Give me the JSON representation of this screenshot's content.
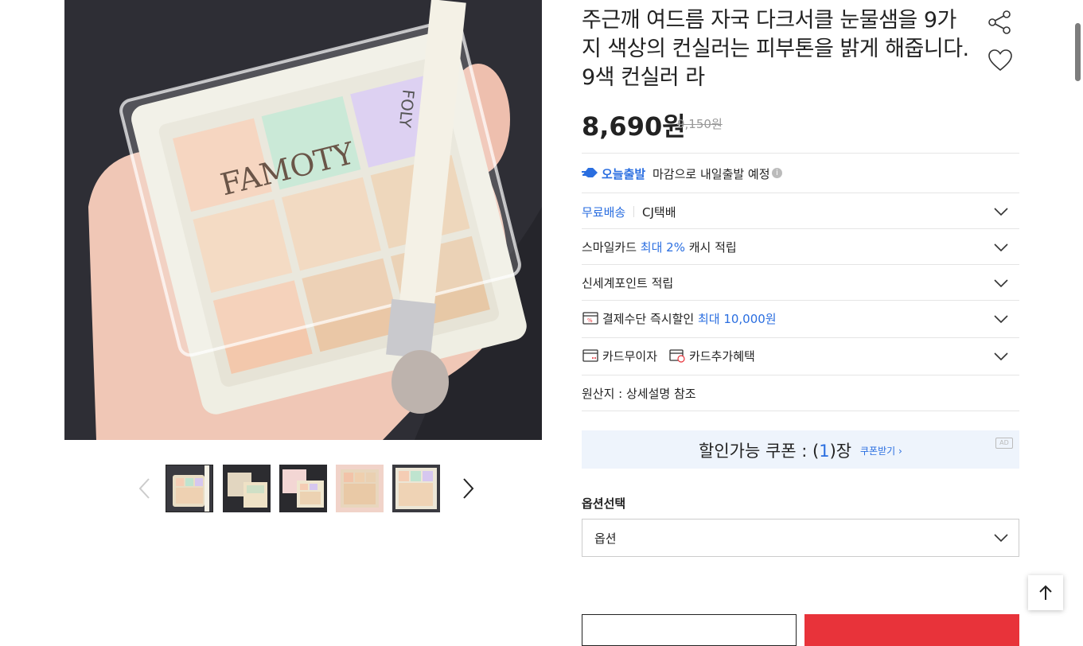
{
  "product": {
    "title": "주근깨 여드름 자국 다크서클 눈물샘을 9가지 색상의 컨실러는 피부톤을 밝게 해줍니다. 9색 컨실러 라",
    "price": "8,690원",
    "original_price": "9,150원",
    "brand_print": "FAMOTY",
    "brush_print": "FOLY"
  },
  "delivery": {
    "today_label": "오늘출발",
    "today_note": "마감으로 내일출발 예정",
    "free_shipping": "무료배송",
    "courier": "CJ택배"
  },
  "benefits": {
    "smilecard_pre": "스마일카드",
    "smilecard_highlight": "최대 2%",
    "smilecard_post": "캐시 적립",
    "shinsegae": "신세계포인트 적립",
    "payment_pre": "결제수단 즉시할인",
    "payment_highlight": "최대 10,000원",
    "card_installment": "카드무이자",
    "card_extra": "카드추가혜택",
    "origin": "원산지 : 상세설명 참조"
  },
  "coupon": {
    "text_pre": "할인가능 쿠폰 : (",
    "count": "1",
    "text_post": ")장",
    "link": "쿠폰받기 ›",
    "ad": "AD"
  },
  "options": {
    "label": "옵션선택",
    "selected": "옵션"
  },
  "colors": {
    "accent_blue": "#2a6ee0",
    "buy_red": "#e8333a"
  }
}
